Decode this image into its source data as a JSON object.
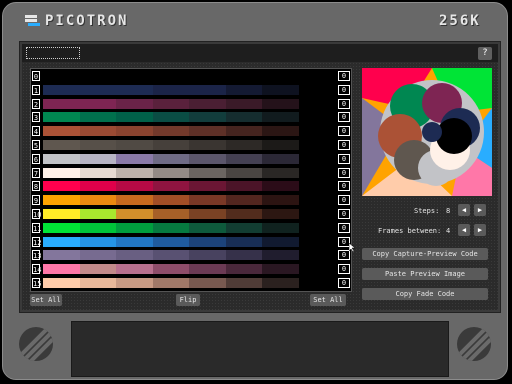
{
  "device": {
    "brand": "PICOTRON",
    "memory": "256K"
  },
  "toolbar": {
    "help_label": "?"
  },
  "palette": {
    "rows": [
      {
        "index": "0",
        "target": "0",
        "colors": [
          "#000000",
          "#000000",
          "#000000",
          "#000000",
          "#000000",
          "#000000",
          "#000000",
          "#000000"
        ]
      },
      {
        "index": "1",
        "target": "0",
        "colors": [
          "#1d2b53",
          "#1d2b53",
          "#1d2b53",
          "#1b2448",
          "#1b2448",
          "#141a33",
          "#0e1220",
          "#000000"
        ]
      },
      {
        "index": "2",
        "target": "0",
        "colors": [
          "#7e2553",
          "#7e2553",
          "#6a2348",
          "#5a213c",
          "#4a1f33",
          "#3a1a28",
          "#24121a",
          "#000000"
        ]
      },
      {
        "index": "3",
        "target": "0",
        "colors": [
          "#008751",
          "#00704d",
          "#006149",
          "#0a4d44",
          "#123d3c",
          "#152d2f",
          "#111b1e",
          "#000000"
        ]
      },
      {
        "index": "4",
        "target": "0",
        "colors": [
          "#ab5236",
          "#9a4a33",
          "#8a432f",
          "#73392b",
          "#5e3027",
          "#45241f",
          "#2b1614",
          "#000000"
        ]
      },
      {
        "index": "5",
        "target": "0",
        "colors": [
          "#5f574f",
          "#575049",
          "#504a44",
          "#46403b",
          "#3a3531",
          "#2d2926",
          "#1c1a18",
          "#000000"
        ]
      },
      {
        "index": "6",
        "target": "0",
        "colors": [
          "#c2c3c7",
          "#b7b4c4",
          "#8a7aa8",
          "#6f6b85",
          "#5b566b",
          "#444052",
          "#2b2836",
          "#000000"
        ]
      },
      {
        "index": "7",
        "target": "0",
        "colors": [
          "#fff1e8",
          "#e6dad2",
          "#bdb2ab",
          "#948b86",
          "#6b6561",
          "#4a4542",
          "#2a2725",
          "#000000"
        ]
      },
      {
        "index": "8",
        "target": "0",
        "colors": [
          "#ff004d",
          "#e0004a",
          "#b70a45",
          "#8f1440",
          "#6b1634",
          "#4b1428",
          "#2b0c18",
          "#000000"
        ]
      },
      {
        "index": "9",
        "target": "0",
        "colors": [
          "#ffa300",
          "#ec8a10",
          "#c86a1e",
          "#a24e26",
          "#7a3826",
          "#52261f",
          "#2c1412",
          "#000000"
        ]
      },
      {
        "index": "10",
        "target": "0",
        "colors": [
          "#ffec27",
          "#a8e72e",
          "#d18f2b",
          "#a66028",
          "#7a4224",
          "#522c1d",
          "#2c1712",
          "#000000"
        ]
      },
      {
        "index": "11",
        "target": "0",
        "colors": [
          "#00e436",
          "#00c43a",
          "#009e3e",
          "#067a40",
          "#0e5a3c",
          "#123d32",
          "#10221f",
          "#000000"
        ]
      },
      {
        "index": "12",
        "target": "0",
        "colors": [
          "#29adff",
          "#2594e6",
          "#2277c5",
          "#1f5b9f",
          "#1c437a",
          "#182e55",
          "#111a30",
          "#000000"
        ]
      },
      {
        "index": "13",
        "target": "0",
        "colors": [
          "#83769c",
          "#776b90",
          "#695f82",
          "#595172",
          "#48425f",
          "#36314a",
          "#201d2e",
          "#000000"
        ]
      },
      {
        "index": "14",
        "target": "0",
        "colors": [
          "#ff77a8",
          "#c28a8a",
          "#b8708e",
          "#8e4d6a",
          "#6b3a54",
          "#4a283b",
          "#2a1722",
          "#000000"
        ]
      },
      {
        "index": "15",
        "target": "0",
        "colors": [
          "#ffccaa",
          "#e8b89a",
          "#c89a84",
          "#a07868",
          "#785950",
          "#503c37",
          "#2b211f",
          "#000000"
        ]
      }
    ]
  },
  "buttons": {
    "set_all_left": "Set All",
    "flip": "Flip",
    "set_all_right": "Set All"
  },
  "controls": {
    "steps_label": "Steps:",
    "steps_value": "8",
    "frames_label": "Frames between:",
    "frames_value": "4",
    "arrow_left": "◀",
    "arrow_right": "▶"
  },
  "actions": {
    "copy_capture": "Copy Capture-Preview Code",
    "paste_preview": "Paste Preview Image",
    "copy_fade": "Copy Fade Code"
  }
}
